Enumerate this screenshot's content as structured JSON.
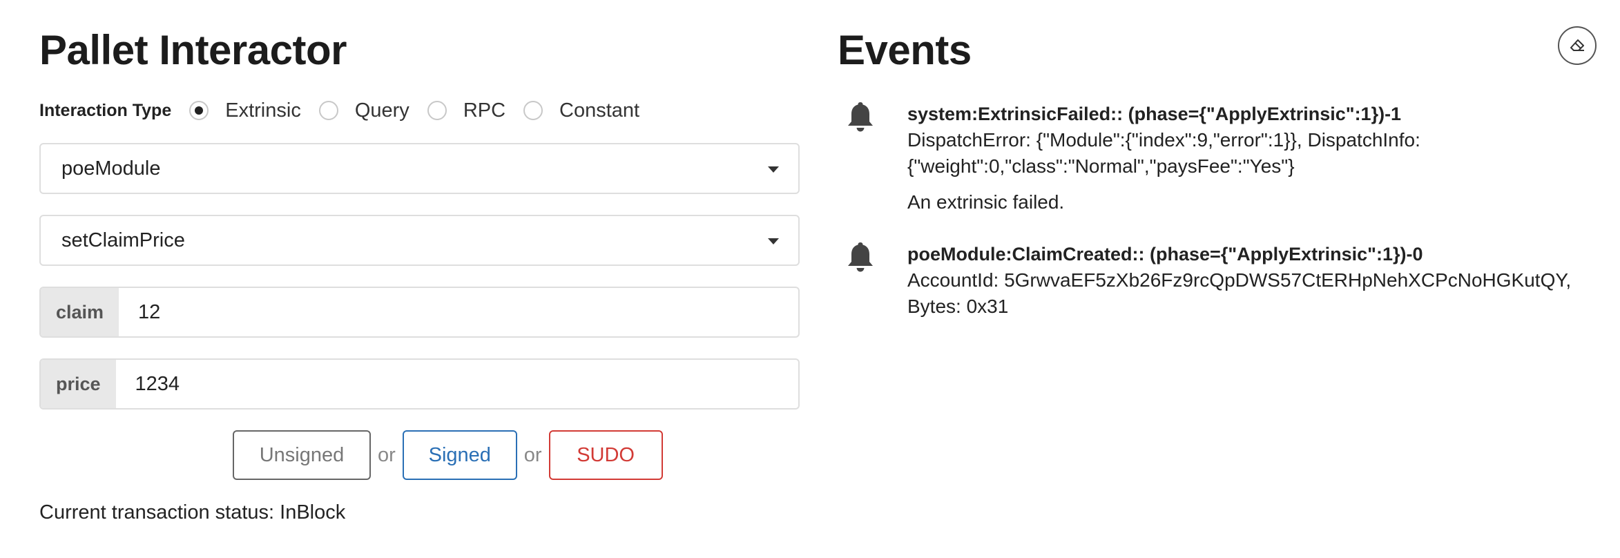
{
  "interactor": {
    "title": "Pallet Interactor",
    "interaction_type_label": "Interaction Type",
    "interaction_types": [
      {
        "label": "Extrinsic",
        "checked": true
      },
      {
        "label": "Query",
        "checked": false
      },
      {
        "label": "RPC",
        "checked": false
      },
      {
        "label": "Constant",
        "checked": false
      }
    ],
    "pallet_select": {
      "value": "poeModule"
    },
    "callable_select": {
      "value": "setClaimPrice"
    },
    "params": [
      {
        "label": "claim",
        "value": "12"
      },
      {
        "label": "price",
        "value": "1234"
      }
    ],
    "buttons": {
      "unsigned": "Unsigned",
      "or1": "or",
      "signed": "Signed",
      "or2": "or",
      "sudo": "SUDO"
    },
    "status": "Current transaction status: InBlock"
  },
  "events": {
    "title": "Events",
    "clear_icon": "eraser-icon",
    "items": [
      {
        "icon": "bell-icon",
        "summary": "system:ExtrinsicFailed:: (phase={\"ApplyExtrinsic\":1})-1",
        "details_line1": "DispatchError: {\"Module\":{\"index\":9,\"error\":1}}, DispatchInfo:",
        "details_line2": "{\"weight\":0,\"class\":\"Normal\",\"paysFee\":\"Yes\"}",
        "description": "An extrinsic failed."
      },
      {
        "icon": "bell-icon",
        "summary": "poeModule:ClaimCreated:: (phase={\"ApplyExtrinsic\":1})-0",
        "details_line1": "AccountId: 5GrwvaEF5zXb26Fz9rcQpDWS57CtERHpNehXCPcNoHGKutQY,",
        "details_line2": "Bytes: 0x31"
      }
    ]
  },
  "colors": {
    "signed": "#2a6fb5",
    "sudo": "#d23a35",
    "unsigned": "#777777"
  }
}
